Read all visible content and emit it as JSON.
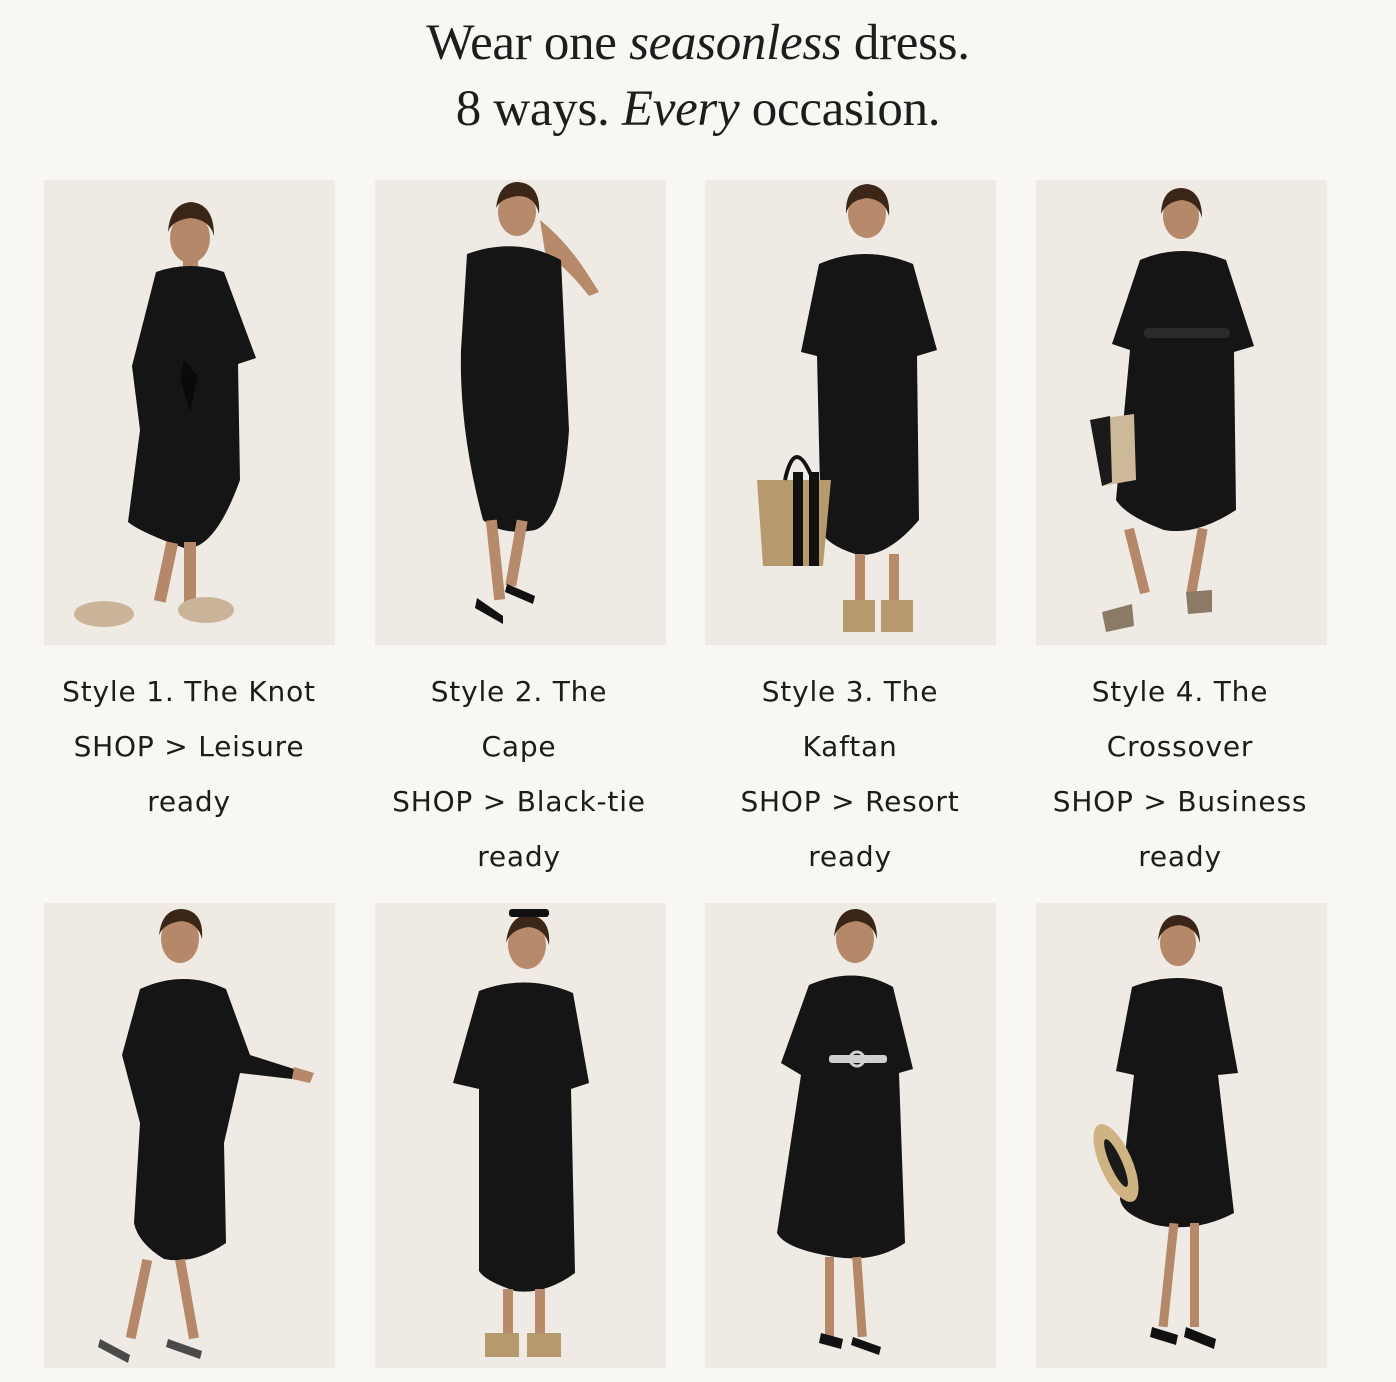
{
  "headline": {
    "line1_pre": "Wear one ",
    "line1_em": "seasonless",
    "line1_post": " dress.",
    "line2_pre": "8 ways. ",
    "line2_em": "Every",
    "line2_post": " occasion."
  },
  "colors": {
    "background": "#f8f7f3",
    "image_bg": "#efebe4",
    "dress": "#141414",
    "text": "#1c1c1c"
  },
  "styles": [
    {
      "title": "Style 1. The Knot",
      "shop": "SHOP > Leisure ready",
      "image_alt": "model in black dress with knot, fur slides"
    },
    {
      "title": "Style 2. The Cape",
      "shop": "SHOP > Black-tie ready",
      "image_alt": "model in black cape dress, strappy heels"
    },
    {
      "title": "Style 3. The Kaftan",
      "shop": "SHOP > Resort ready",
      "image_alt": "model in black kaftan with Chloé tote"
    },
    {
      "title": "Style 4. The Crossover",
      "shop": "SHOP > Business ready",
      "image_alt": "model in belted black dress with handbag"
    },
    {
      "image_alt": "model in wrapped black dress, metallic pumps"
    },
    {
      "image_alt": "model in black dress, hand in pocket, sunglasses on head"
    },
    {
      "image_alt": "model in black dress with chain belt"
    },
    {
      "image_alt": "model in black dress with straw hat"
    }
  ]
}
